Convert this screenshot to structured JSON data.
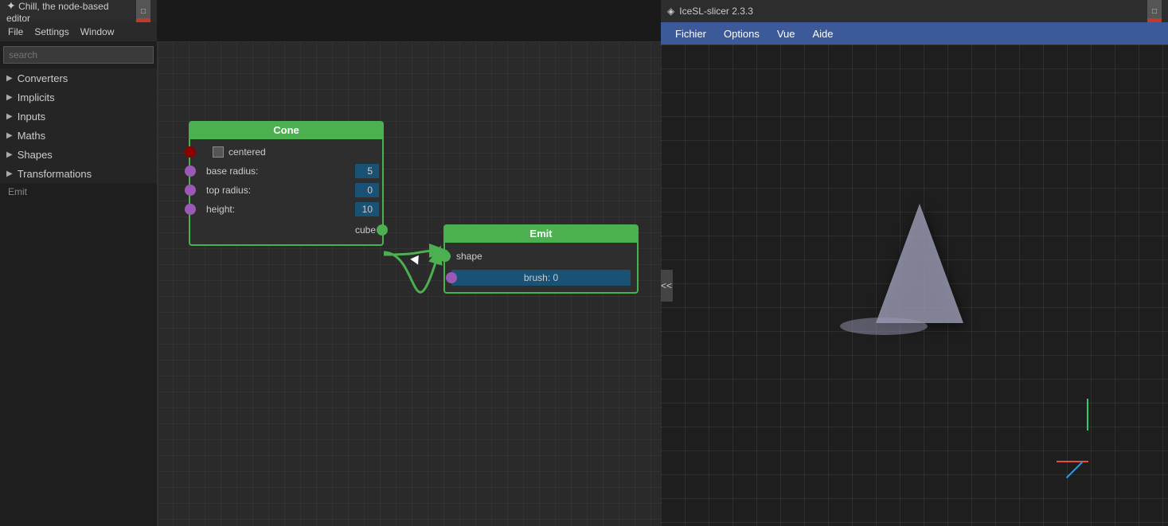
{
  "app_chill": {
    "title": "Chill, the node-based editor",
    "icon": "✦",
    "win_controls": {
      "minimize": "−",
      "maximize": "□",
      "close": "✕"
    }
  },
  "menu_chill": {
    "items": [
      "File",
      "Settings",
      "Window"
    ]
  },
  "sidebar": {
    "search_placeholder": "search",
    "items": [
      {
        "label": "Converters",
        "arrow": "▶"
      },
      {
        "label": "Implicits",
        "arrow": "▶"
      },
      {
        "label": "Inputs",
        "arrow": "▶"
      },
      {
        "label": "Maths",
        "arrow": "▶"
      },
      {
        "label": "Shapes",
        "arrow": "▶"
      },
      {
        "label": "Transformations",
        "arrow": "▶"
      }
    ],
    "emit_label": "Emit"
  },
  "nodes": {
    "cone": {
      "title": "Cone",
      "fields": [
        {
          "label": "centered",
          "type": "checkbox",
          "has_port": true,
          "port_color": "dark-red"
        },
        {
          "label": "base radius:",
          "value": "5",
          "has_port": true
        },
        {
          "label": "top radius:",
          "value": "0",
          "has_port": true
        },
        {
          "label": "height:",
          "value": "10",
          "has_port": true
        }
      ],
      "output_label": "cube"
    },
    "emit": {
      "title": "Emit",
      "input_label": "shape",
      "brush_label": "brush: 0"
    }
  },
  "icesl": {
    "title": "IceSL-slicer 2.3.3",
    "icon": "◈",
    "win_controls": {
      "minimize": "−",
      "maximize": "□",
      "close": "✕"
    },
    "menu": [
      "Fichier",
      "Options",
      "Vue",
      "Aide"
    ],
    "collapse_arrow": "<<"
  }
}
